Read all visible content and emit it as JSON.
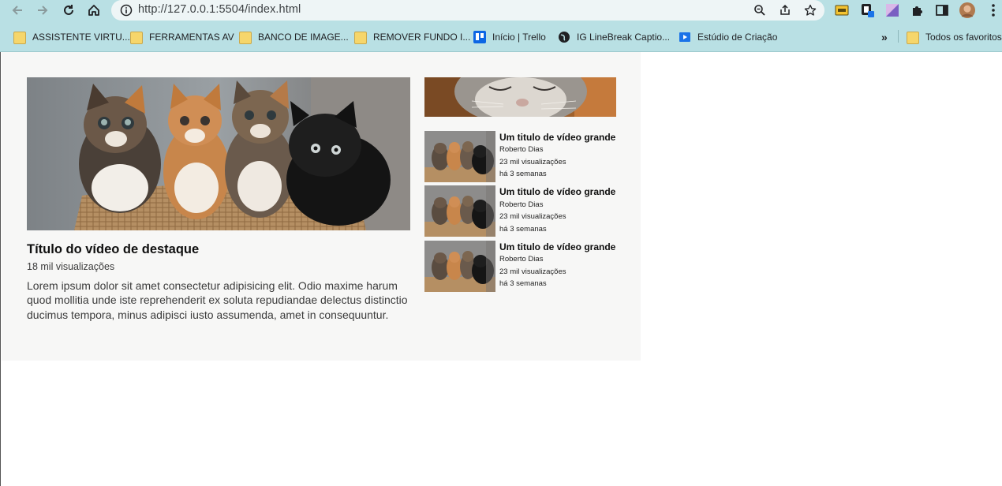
{
  "browser": {
    "url": "http://127.0.0.1:5504/index.html",
    "icons": {
      "back": "back-arrow-icon",
      "forward": "forward-arrow-icon",
      "reload": "reload-icon",
      "home": "home-icon",
      "info": "info-icon",
      "zoom": "zoom-icon",
      "share": "share-icon",
      "star": "star-icon",
      "extensions": "puzzle-icon",
      "sidepanel": "side-panel-icon",
      "menu": "three-dots-icon"
    }
  },
  "bookmarks": {
    "items": [
      {
        "label": "ASSISTENTE VIRTU...",
        "icon": "folder-icon"
      },
      {
        "label": "FERRAMENTAS AV",
        "icon": "folder-icon"
      },
      {
        "label": "BANCO DE IMAGE...",
        "icon": "folder-icon"
      },
      {
        "label": "REMOVER FUNDO I...",
        "icon": "folder-icon"
      },
      {
        "label": "Início | Trello",
        "icon": "trello-icon"
      },
      {
        "label": "IG LineBreak Captio...",
        "icon": "globe-icon"
      },
      {
        "label": "Estúdio de Criação",
        "icon": "studio-icon"
      }
    ],
    "overflow": "»",
    "all_favorites": "Todos os favoritos"
  },
  "featured": {
    "title": "Título do vídeo de destaque",
    "views": "18 mil visualizações",
    "description": "Lorem ipsum dolor sit amet consectetur adipisicing elit. Odio maxime harum quod mollitia unde iste reprehenderit ex soluta repudiandae delectus distinctio ducimus tempora, minus adipisci iusto assumenda, amet in consequuntur."
  },
  "sidebar": {
    "videos": [
      {
        "title": "Um titulo de vídeo grande",
        "channel": "Roberto Dias",
        "views": "23 mil visualizações",
        "age": "há 3 semanas"
      },
      {
        "title": "Um titulo de vídeo grande",
        "channel": "Roberto Dias",
        "views": "23 mil visualizações",
        "age": "há 3 semanas"
      },
      {
        "title": "Um titulo de vídeo grande",
        "channel": "Roberto Dias",
        "views": "23 mil visualizações",
        "age": "há 3 semanas"
      }
    ]
  },
  "colors": {
    "browser_chrome": "#b9e0e4",
    "content_bg": "#f7f7f6"
  }
}
